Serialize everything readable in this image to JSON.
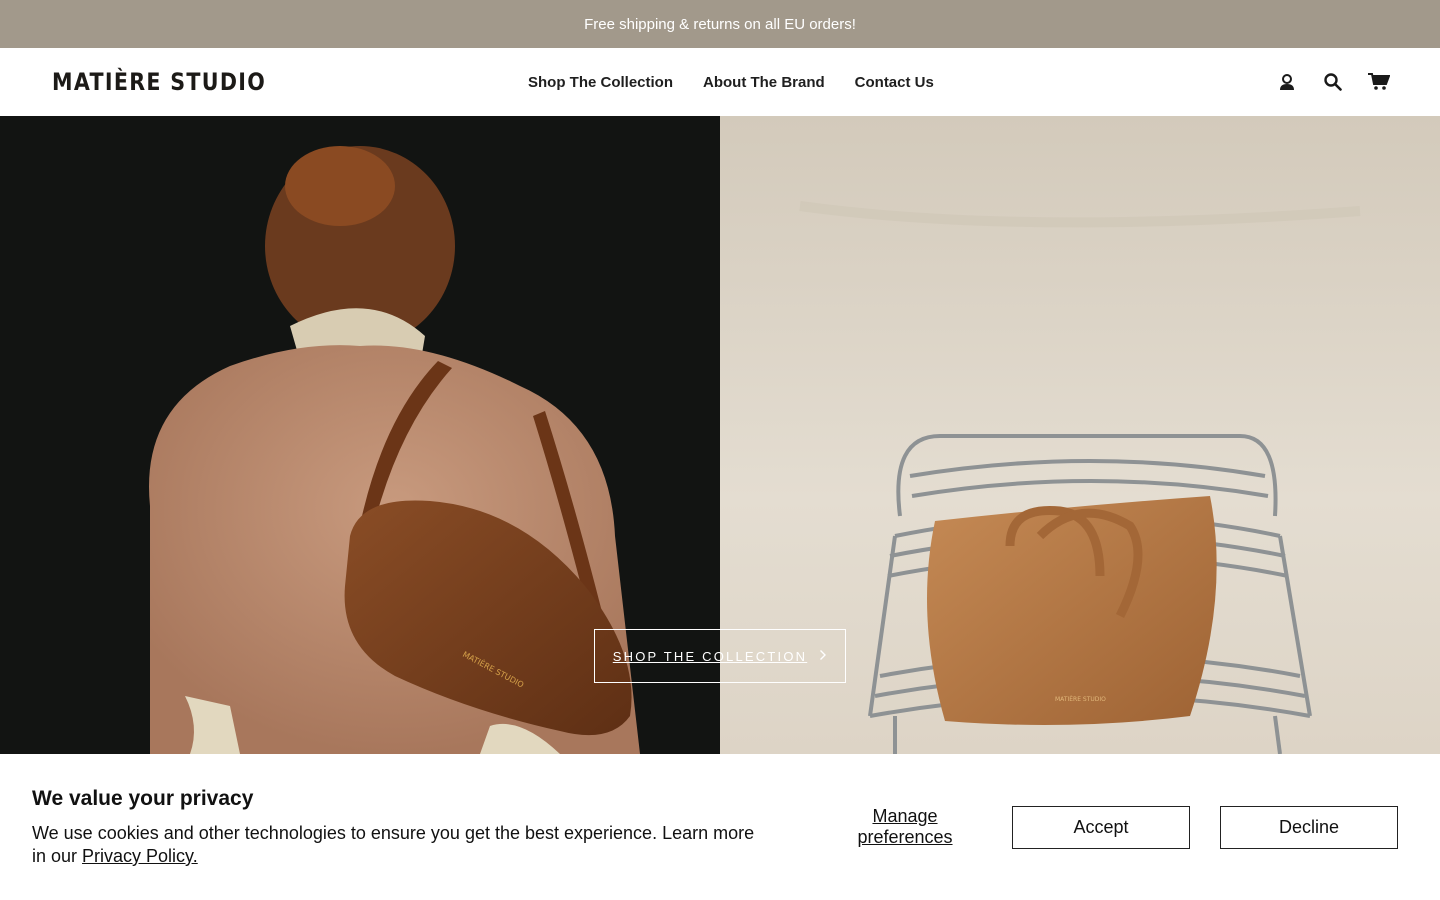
{
  "announcement": {
    "text": "Free shipping & returns on all EU orders!"
  },
  "header": {
    "logo": "MATIÈRE STUDIO",
    "nav": [
      {
        "label": "Shop The Collection"
      },
      {
        "label": "About The Brand"
      },
      {
        "label": "Contact Us"
      }
    ],
    "icons": [
      "account-icon",
      "search-icon",
      "cart-icon"
    ]
  },
  "hero": {
    "left_image": "model with brown leather shoulder bag on black background",
    "right_image": "tan leather tote on chrome chair against plaster wall",
    "bag_stamp": "MATIÈRE STUDIO",
    "cta_label": "SHOP THE COLLECTION",
    "cta_icon": "chevron-right-icon"
  },
  "consent": {
    "title": "We value your privacy",
    "body": "We use cookies and other technologies to ensure you get the best experience. Learn more in our ",
    "link": "Privacy Policy.",
    "manage_label": "Manage preferences",
    "accept_label": "Accept",
    "decline_label": "Decline"
  },
  "colors": {
    "announcement_bg": "#a2998b",
    "text": "#1a1a1a",
    "hero_left_bg": "#121412",
    "hero_right_bg": "#ddd5c8",
    "leather": "#7a4523"
  }
}
